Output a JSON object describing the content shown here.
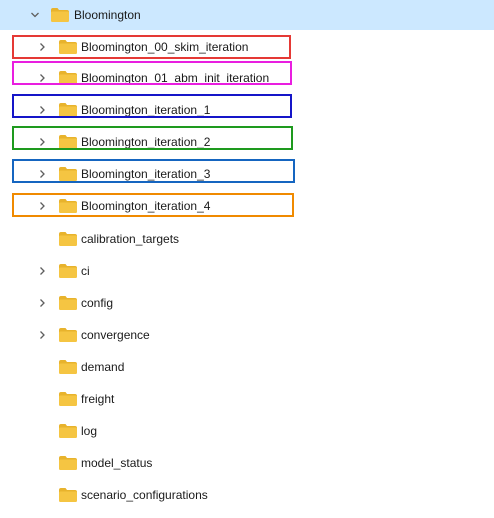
{
  "tree": {
    "root": {
      "label": "Bloomington",
      "expanded": true,
      "selected": true,
      "highlight_color": "#cce8ff"
    },
    "items": [
      {
        "label": "Bloomington_00_skim_iteration",
        "has_children": true,
        "outline_color": "#e53935"
      },
      {
        "label": "Bloomington_01_abm_init_iteration",
        "has_children": true,
        "outline_color": "#e91ee0"
      },
      {
        "label": "Bloomington_iteration_1",
        "has_children": true,
        "outline_color": "#1515c8"
      },
      {
        "label": "Bloomington_iteration_2",
        "has_children": true,
        "outline_color": "#1e9a1e"
      },
      {
        "label": "Bloomington_iteration_3",
        "has_children": true,
        "outline_color": "#1565c0"
      },
      {
        "label": "Bloomington_iteration_4",
        "has_children": true,
        "outline_color": "#f08a00"
      },
      {
        "label": "calibration_targets",
        "has_children": false
      },
      {
        "label": "ci",
        "has_children": true
      },
      {
        "label": "config",
        "has_children": true
      },
      {
        "label": "convergence",
        "has_children": true
      },
      {
        "label": "demand",
        "has_children": false
      },
      {
        "label": "freight",
        "has_children": false
      },
      {
        "label": "log",
        "has_children": false
      },
      {
        "label": "model_status",
        "has_children": false
      },
      {
        "label": "scenario_configurations",
        "has_children": false
      }
    ]
  },
  "icons": {
    "folder": "folder-icon",
    "expand": "chevron-right-icon",
    "collapse": "chevron-down-icon"
  },
  "colors": {
    "folder_body": "#f5c542",
    "folder_tab": "#e8b32c",
    "chevron": "#5f5f5f"
  }
}
